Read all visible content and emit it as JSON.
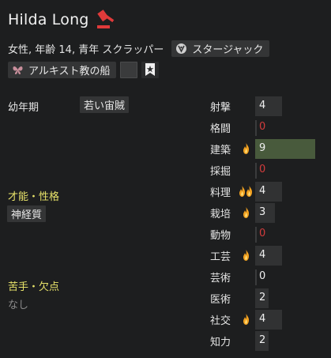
{
  "pawn": {
    "name": "Hilda Long",
    "description": "女性, 年齢 14, 青年 スクラッパー",
    "faction_tag": "スタージャック",
    "ideo_tag": "アルキスト教の船"
  },
  "backstory": {
    "label": "幼年期",
    "value": "若い宙賊"
  },
  "traits": {
    "title": "才能・性格",
    "items": [
      "神経質"
    ]
  },
  "incapable": {
    "title": "苦手・欠点",
    "none_text": "なし"
  },
  "skills": [
    {
      "label": "射撃",
      "value": "4",
      "passion": "none",
      "level": 4
    },
    {
      "label": "格闘",
      "value": "0",
      "passion": "none",
      "level": 0
    },
    {
      "label": "建築",
      "value": "9",
      "passion": "minor",
      "level": 9
    },
    {
      "label": "採掘",
      "value": "0",
      "passion": "none",
      "level": 0
    },
    {
      "label": "料理",
      "value": "4",
      "passion": "major",
      "level": 4
    },
    {
      "label": "栽培",
      "value": "3",
      "passion": "minor",
      "level": 3
    },
    {
      "label": "動物",
      "value": "0",
      "passion": "none",
      "level": 0
    },
    {
      "label": "工芸",
      "value": "4",
      "passion": "minor",
      "level": 4
    },
    {
      "label": "芸術",
      "value": "0",
      "passion": "none",
      "level": 0,
      "disabled_look": true
    },
    {
      "label": "医術",
      "value": "2",
      "passion": "none",
      "level": 2
    },
    {
      "label": "社交",
      "value": "4",
      "passion": "minor",
      "level": 4
    },
    {
      "label": "知力",
      "value": "2",
      "passion": "none",
      "level": 2
    }
  ],
  "colors": {
    "faction": "#e03a3a",
    "section_title": "#e8e36a",
    "zero_value": "#d33c3c",
    "passion_flame": "#f0a020"
  }
}
